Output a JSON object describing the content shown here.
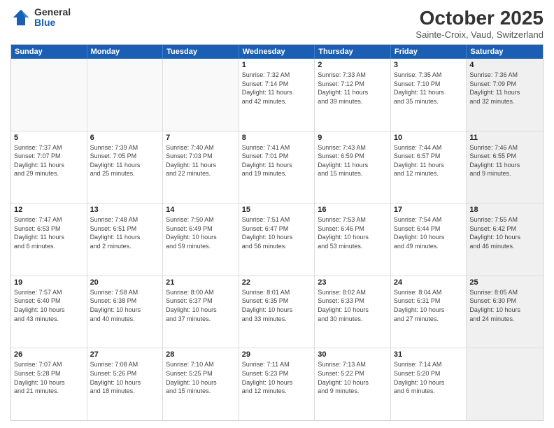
{
  "logo": {
    "general": "General",
    "blue": "Blue"
  },
  "header": {
    "month": "October 2025",
    "location": "Sainte-Croix, Vaud, Switzerland"
  },
  "days_of_week": [
    "Sunday",
    "Monday",
    "Tuesday",
    "Wednesday",
    "Thursday",
    "Friday",
    "Saturday"
  ],
  "weeks": [
    [
      {
        "num": "",
        "info": "",
        "empty": true
      },
      {
        "num": "",
        "info": "",
        "empty": true
      },
      {
        "num": "",
        "info": "",
        "empty": true
      },
      {
        "num": "1",
        "info": "Sunrise: 7:32 AM\nSunset: 7:14 PM\nDaylight: 11 hours\nand 42 minutes.",
        "empty": false
      },
      {
        "num": "2",
        "info": "Sunrise: 7:33 AM\nSunset: 7:12 PM\nDaylight: 11 hours\nand 39 minutes.",
        "empty": false
      },
      {
        "num": "3",
        "info": "Sunrise: 7:35 AM\nSunset: 7:10 PM\nDaylight: 11 hours\nand 35 minutes.",
        "empty": false
      },
      {
        "num": "4",
        "info": "Sunrise: 7:36 AM\nSunset: 7:09 PM\nDaylight: 11 hours\nand 32 minutes.",
        "empty": false,
        "shaded": true
      }
    ],
    [
      {
        "num": "5",
        "info": "Sunrise: 7:37 AM\nSunset: 7:07 PM\nDaylight: 11 hours\nand 29 minutes.",
        "empty": false
      },
      {
        "num": "6",
        "info": "Sunrise: 7:39 AM\nSunset: 7:05 PM\nDaylight: 11 hours\nand 25 minutes.",
        "empty": false
      },
      {
        "num": "7",
        "info": "Sunrise: 7:40 AM\nSunset: 7:03 PM\nDaylight: 11 hours\nand 22 minutes.",
        "empty": false
      },
      {
        "num": "8",
        "info": "Sunrise: 7:41 AM\nSunset: 7:01 PM\nDaylight: 11 hours\nand 19 minutes.",
        "empty": false
      },
      {
        "num": "9",
        "info": "Sunrise: 7:43 AM\nSunset: 6:59 PM\nDaylight: 11 hours\nand 15 minutes.",
        "empty": false
      },
      {
        "num": "10",
        "info": "Sunrise: 7:44 AM\nSunset: 6:57 PM\nDaylight: 11 hours\nand 12 minutes.",
        "empty": false
      },
      {
        "num": "11",
        "info": "Sunrise: 7:46 AM\nSunset: 6:55 PM\nDaylight: 11 hours\nand 9 minutes.",
        "empty": false,
        "shaded": true
      }
    ],
    [
      {
        "num": "12",
        "info": "Sunrise: 7:47 AM\nSunset: 6:53 PM\nDaylight: 11 hours\nand 6 minutes.",
        "empty": false
      },
      {
        "num": "13",
        "info": "Sunrise: 7:48 AM\nSunset: 6:51 PM\nDaylight: 11 hours\nand 2 minutes.",
        "empty": false
      },
      {
        "num": "14",
        "info": "Sunrise: 7:50 AM\nSunset: 6:49 PM\nDaylight: 10 hours\nand 59 minutes.",
        "empty": false
      },
      {
        "num": "15",
        "info": "Sunrise: 7:51 AM\nSunset: 6:47 PM\nDaylight: 10 hours\nand 56 minutes.",
        "empty": false
      },
      {
        "num": "16",
        "info": "Sunrise: 7:53 AM\nSunset: 6:46 PM\nDaylight: 10 hours\nand 53 minutes.",
        "empty": false
      },
      {
        "num": "17",
        "info": "Sunrise: 7:54 AM\nSunset: 6:44 PM\nDaylight: 10 hours\nand 49 minutes.",
        "empty": false
      },
      {
        "num": "18",
        "info": "Sunrise: 7:55 AM\nSunset: 6:42 PM\nDaylight: 10 hours\nand 46 minutes.",
        "empty": false,
        "shaded": true
      }
    ],
    [
      {
        "num": "19",
        "info": "Sunrise: 7:57 AM\nSunset: 6:40 PM\nDaylight: 10 hours\nand 43 minutes.",
        "empty": false
      },
      {
        "num": "20",
        "info": "Sunrise: 7:58 AM\nSunset: 6:38 PM\nDaylight: 10 hours\nand 40 minutes.",
        "empty": false
      },
      {
        "num": "21",
        "info": "Sunrise: 8:00 AM\nSunset: 6:37 PM\nDaylight: 10 hours\nand 37 minutes.",
        "empty": false
      },
      {
        "num": "22",
        "info": "Sunrise: 8:01 AM\nSunset: 6:35 PM\nDaylight: 10 hours\nand 33 minutes.",
        "empty": false
      },
      {
        "num": "23",
        "info": "Sunrise: 8:02 AM\nSunset: 6:33 PM\nDaylight: 10 hours\nand 30 minutes.",
        "empty": false
      },
      {
        "num": "24",
        "info": "Sunrise: 8:04 AM\nSunset: 6:31 PM\nDaylight: 10 hours\nand 27 minutes.",
        "empty": false
      },
      {
        "num": "25",
        "info": "Sunrise: 8:05 AM\nSunset: 6:30 PM\nDaylight: 10 hours\nand 24 minutes.",
        "empty": false,
        "shaded": true
      }
    ],
    [
      {
        "num": "26",
        "info": "Sunrise: 7:07 AM\nSunset: 5:28 PM\nDaylight: 10 hours\nand 21 minutes.",
        "empty": false
      },
      {
        "num": "27",
        "info": "Sunrise: 7:08 AM\nSunset: 5:26 PM\nDaylight: 10 hours\nand 18 minutes.",
        "empty": false
      },
      {
        "num": "28",
        "info": "Sunrise: 7:10 AM\nSunset: 5:25 PM\nDaylight: 10 hours\nand 15 minutes.",
        "empty": false
      },
      {
        "num": "29",
        "info": "Sunrise: 7:11 AM\nSunset: 5:23 PM\nDaylight: 10 hours\nand 12 minutes.",
        "empty": false
      },
      {
        "num": "30",
        "info": "Sunrise: 7:13 AM\nSunset: 5:22 PM\nDaylight: 10 hours\nand 9 minutes.",
        "empty": false
      },
      {
        "num": "31",
        "info": "Sunrise: 7:14 AM\nSunset: 5:20 PM\nDaylight: 10 hours\nand 6 minutes.",
        "empty": false
      },
      {
        "num": "",
        "info": "",
        "empty": true,
        "shaded": true
      }
    ]
  ]
}
